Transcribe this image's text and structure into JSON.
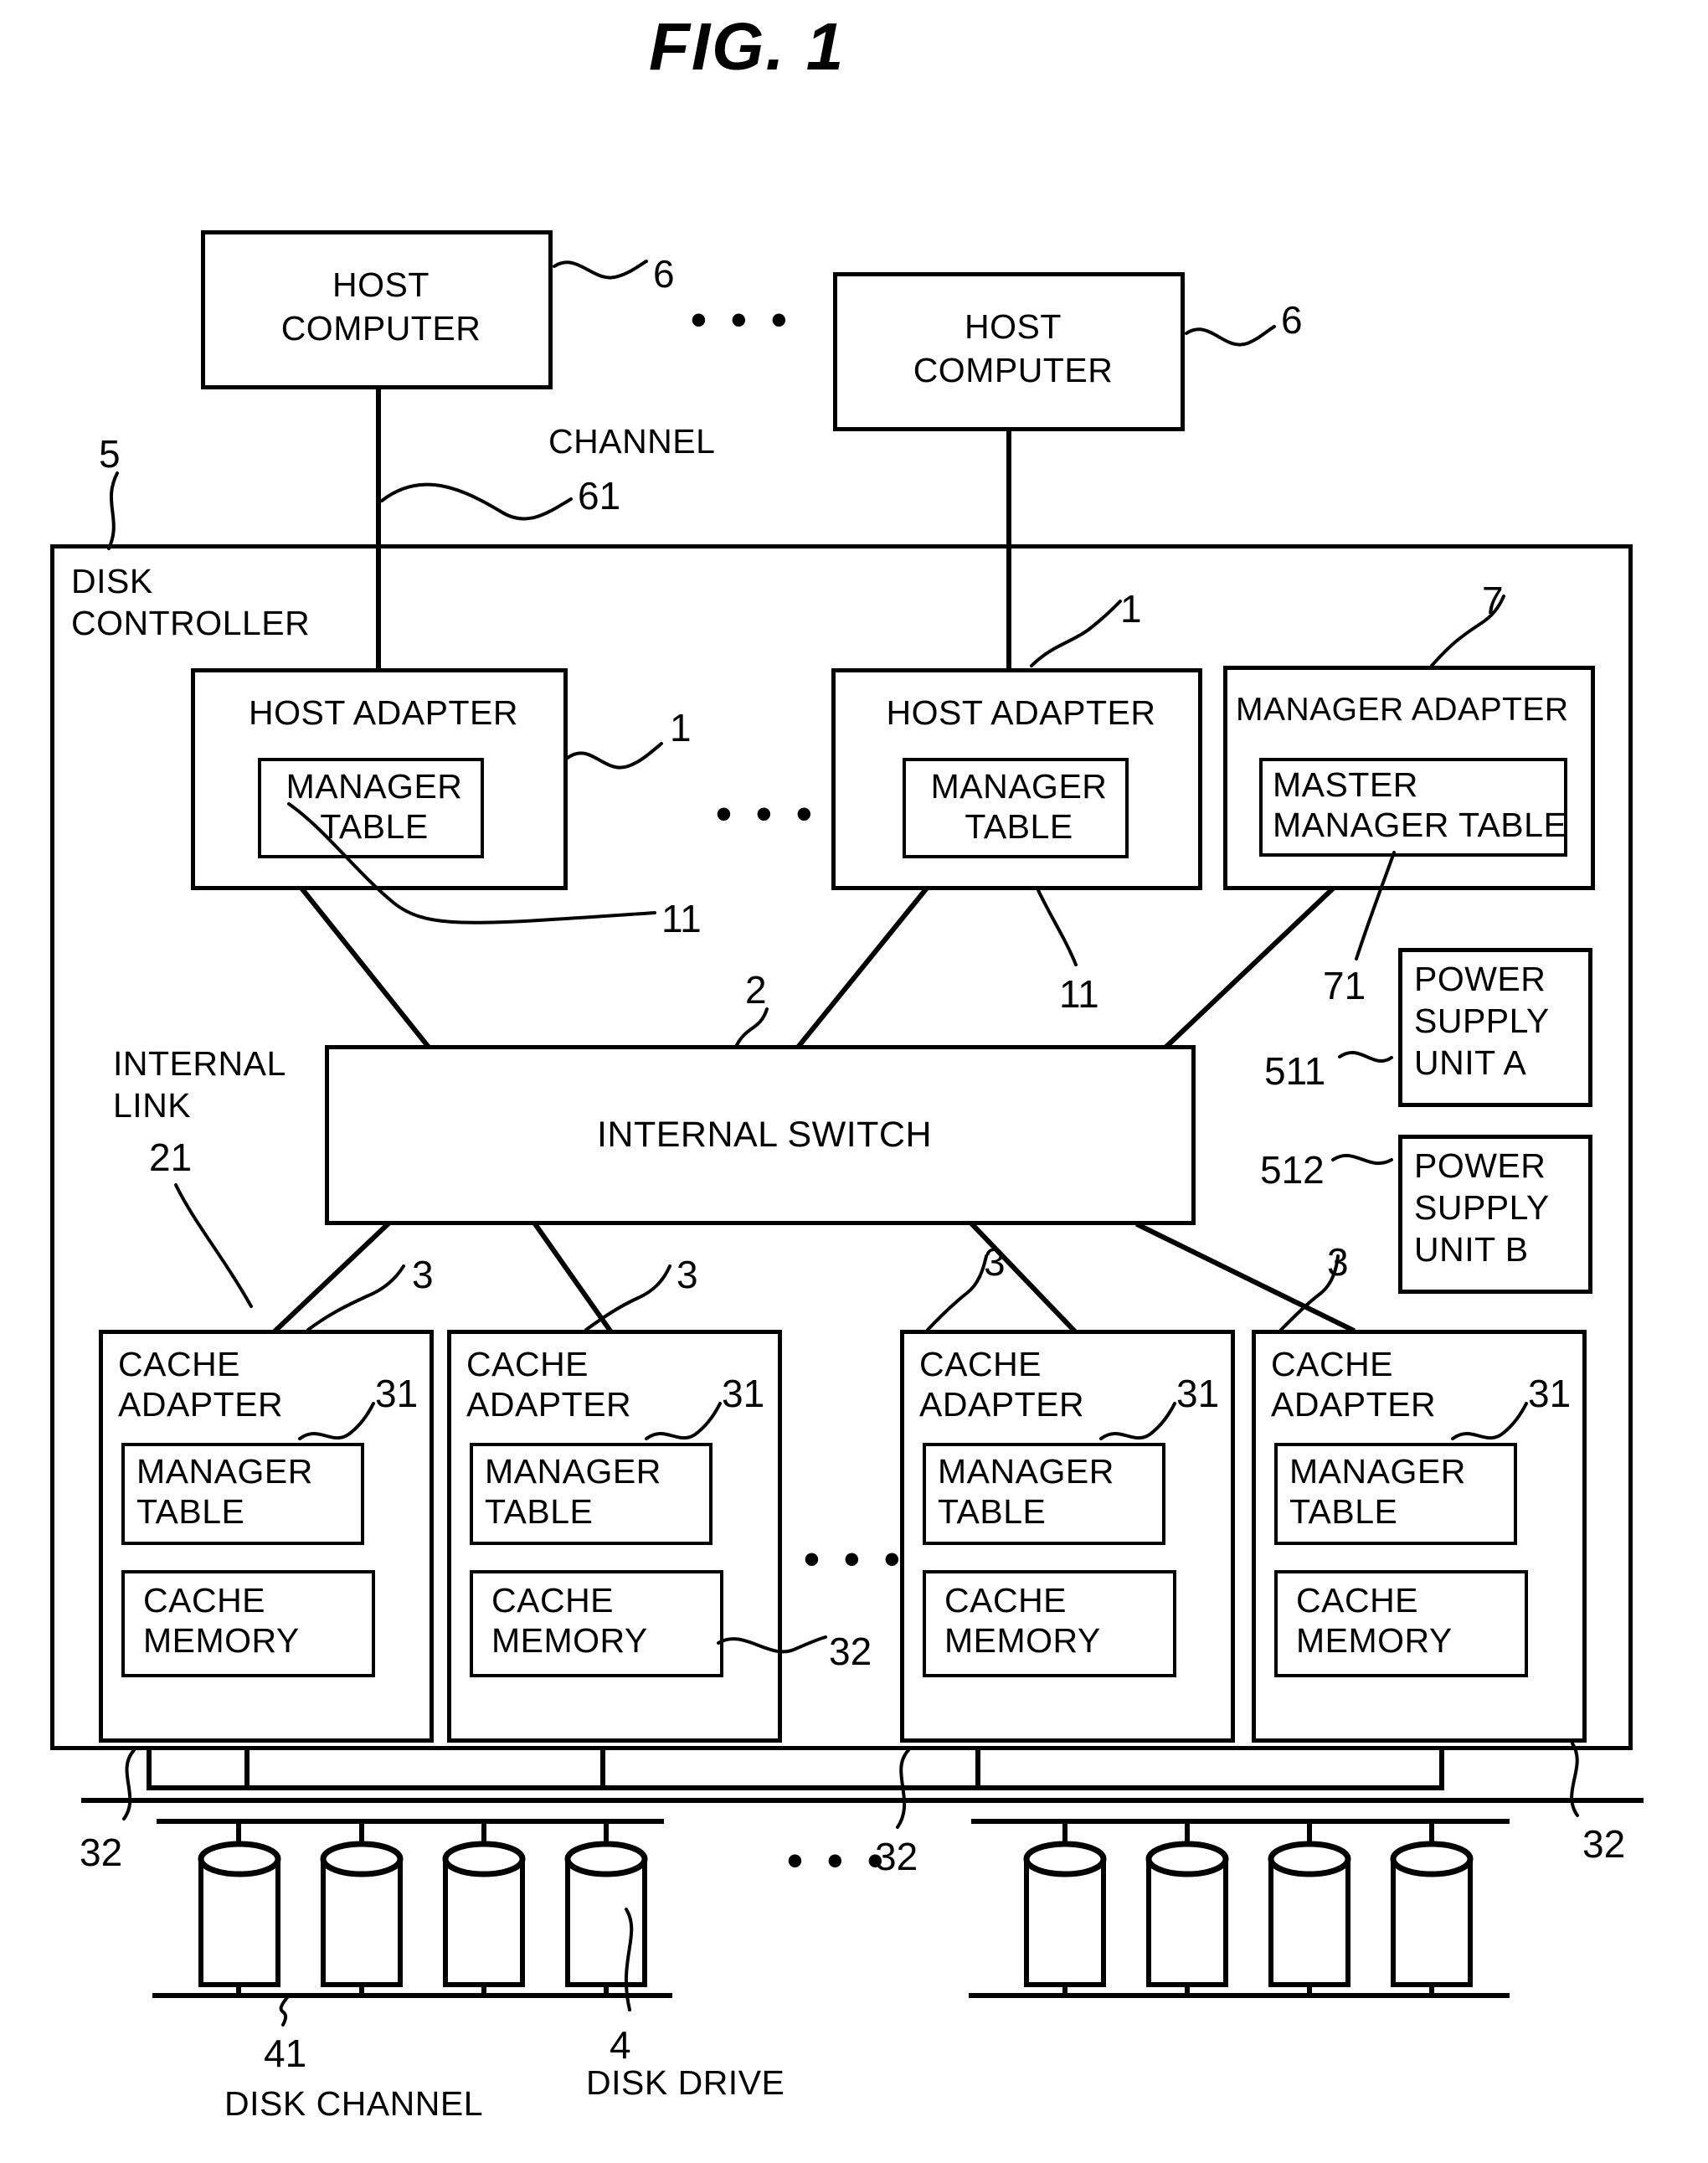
{
  "figure": {
    "title": "FIG. 1"
  },
  "hosts": [
    {
      "line1": "HOST",
      "line2": "COMPUTER",
      "ref": "6"
    },
    {
      "line1": "HOST",
      "line2": "COMPUTER",
      "ref": "6"
    }
  ],
  "ellipsis": "• • •",
  "channel": {
    "label": "CHANNEL",
    "ref": "61"
  },
  "controller": {
    "line1": "DISK",
    "line2": "CONTROLLER",
    "ref": "5"
  },
  "host_adapters": [
    {
      "title": "HOST ADAPTER",
      "ref": "1",
      "table": {
        "line1": "MANAGER",
        "line2": "TABLE",
        "ref": "11"
      }
    },
    {
      "title": "HOST ADAPTER",
      "ref": "1",
      "table": {
        "line1": "MANAGER",
        "line2": "TABLE",
        "ref": "11"
      }
    }
  ],
  "manager_adapter": {
    "title": "MANAGER ADAPTER",
    "ref": "7",
    "table": {
      "line1": "MASTER",
      "line2": "MANAGER TABLE",
      "ref": "71"
    }
  },
  "power_supplies": [
    {
      "line1": "POWER",
      "line2": "SUPPLY",
      "line3": "UNIT A",
      "ref": "511"
    },
    {
      "line1": "POWER",
      "line2": "SUPPLY",
      "line3": "UNIT B",
      "ref": "512"
    }
  ],
  "internal_switch": {
    "label": "INTERNAL SWITCH",
    "ref": "2"
  },
  "internal_link": {
    "line1": "INTERNAL",
    "line2": "LINK",
    "ref": "21"
  },
  "cache_adapters": [
    {
      "line1": "CACHE",
      "line2": "ADAPTER",
      "ref": "3",
      "manager_table": {
        "line1": "MANAGER",
        "line2": "TABLE",
        "ref": "31"
      },
      "cache_memory": {
        "line1": "CACHE",
        "line2": "MEMORY"
      }
    },
    {
      "line1": "CACHE",
      "line2": "ADAPTER",
      "ref": "3",
      "manager_table": {
        "line1": "MANAGER",
        "line2": "TABLE",
        "ref": "31"
      },
      "cache_memory": {
        "line1": "CACHE",
        "line2": "MEMORY"
      }
    },
    {
      "line1": "CACHE",
      "line2": "ADAPTER",
      "ref": "3",
      "manager_table": {
        "line1": "MANAGER",
        "line2": "TABLE",
        "ref": "31"
      },
      "cache_memory": {
        "line1": "CACHE",
        "line2": "MEMORY"
      }
    },
    {
      "line1": "CACHE",
      "line2": "ADAPTER",
      "ref": "3",
      "manager_table": {
        "line1": "MANAGER",
        "line2": "TABLE",
        "ref": "31"
      },
      "cache_memory": {
        "line1": "CACHE",
        "line2": "MEMORY"
      }
    }
  ],
  "disk_channel_refs": {
    "left": "32",
    "mid_left": "32",
    "mid_right": "32",
    "right": "32"
  },
  "bottom_labels": {
    "disk_channel_ref": "41",
    "disk_channel": "DISK CHANNEL",
    "disk_drive_ref": "4",
    "disk_drive": "DISK DRIVE"
  }
}
